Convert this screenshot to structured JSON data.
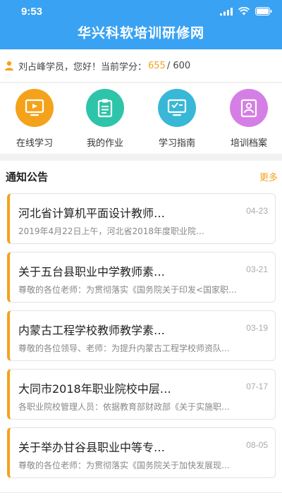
{
  "status_bar": {
    "time": "9:53"
  },
  "app": {
    "title": "华兴科软培训研修网"
  },
  "user": {
    "greeting": "刘占峰学员，您好！当前学分：",
    "credits": "655",
    "credits_total": "/ 600"
  },
  "quick_menu": [
    {
      "label": "在线学习",
      "color": "#f5a21b"
    },
    {
      "label": "我的作业",
      "color": "#2ec4a9"
    },
    {
      "label": "学习指南",
      "color": "#38b8d6"
    },
    {
      "label": "培训档案",
      "color": "#d57fe6"
    }
  ],
  "notice": {
    "title": "通知公告",
    "more": "更多",
    "items": [
      {
        "title": "河北省计算机平面设计教师…",
        "date": "04-23",
        "summary": "2019年4月22日上午，河北省2018年度职业院…"
      },
      {
        "title": "关于五台县职业中学教师素…",
        "date": "03-21",
        "summary": "尊敬的各位老师：为贯彻落实《国务院关于印发<国家职…"
      },
      {
        "title": "内蒙古工程学校教师教学素…",
        "date": "03-19",
        "summary": "尊敬的各位领导、老师：为提升内蒙古工程学校师资队…"
      },
      {
        "title": "大同市2018年职业院校中层…",
        "date": "07-17",
        "summary": "各职业院校管理人员：依据教育部财政部《关于实施职…"
      },
      {
        "title": "关于举办甘谷县职业中等专…",
        "date": "08-05",
        "summary": "尊敬的各位老师：为贯彻落实《国务院关于加快发展现…"
      }
    ]
  },
  "colors": {
    "header": "#3aa2f2",
    "accent": "#f5a21b"
  }
}
